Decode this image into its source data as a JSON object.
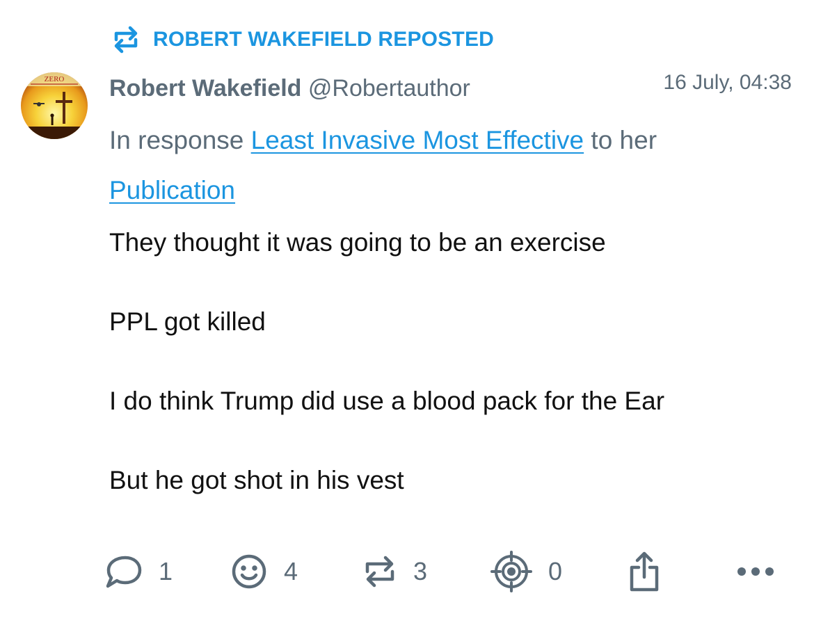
{
  "repost_banner": {
    "label": "ROBERT WAKEFIELD REPOSTED",
    "icon": "repost-icon",
    "color": "#1b95e0"
  },
  "post": {
    "author_name": "Robert Wakefield",
    "author_handle": "@Robertauthor",
    "timestamp": "16 July, 04:38",
    "avatar_text": "ZERO",
    "response_prefix": "In response ",
    "response_link": "Least Invasive Most Effective",
    "response_middle": " to her",
    "response_link2": "Publication",
    "lines": [
      "They thought it was going to be an exercise",
      "PPL got killed",
      "I do think Trump did use a blood pack for the Ear",
      "But he got shot in his vest"
    ]
  },
  "actions": {
    "replies": "1",
    "reactions": "4",
    "reposts": "3",
    "quotes": "0",
    "icons": [
      "comment-icon",
      "smiley-icon",
      "repost-icon",
      "target-icon",
      "share-icon",
      "more-icon"
    ]
  },
  "colors": {
    "accent": "#1b95e0",
    "muted": "#5b6b78",
    "text": "#111111"
  }
}
